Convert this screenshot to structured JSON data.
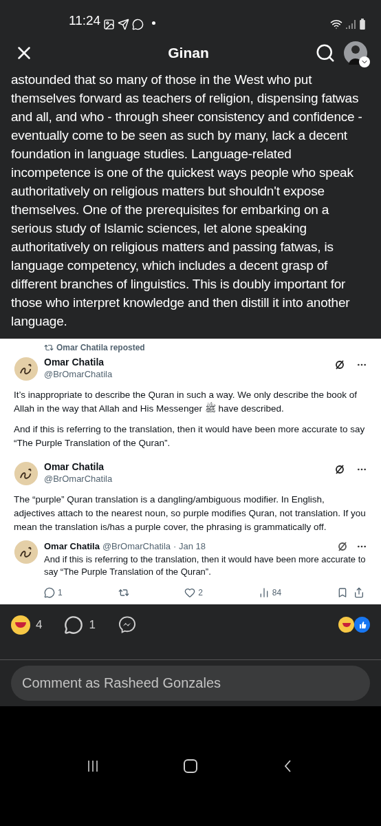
{
  "status_bar": {
    "time": "11:24"
  },
  "header": {
    "title": "Ginan"
  },
  "post": {
    "text": "astounded that so many of those in the West who put themselves forward as teachers of religion, dispensing fatwas and all, and who - through sheer consistency and confidence - eventually come to be seen as such by many, lack a decent foundation in language studies. Language-related incompetence is one of the quickest ways people who speak authoritatively on religious matters but shouldn't expose themselves. One of the prerequisites for embarking on a serious study of Islamic sciences, let alone speaking authoritatively on religious matters and passing fatwas, is language competency, which includes a decent grasp of different branches of linguistics. This is doubly important for those who interpret knowledge and then distill it into another language."
  },
  "screenshot": {
    "repost_label": "Omar Chatila reposted",
    "tweets": [
      {
        "name": "Omar Chatila",
        "handle": "@BrOmarChatila",
        "paragraphs": [
          "It’s inappropriate to describe the Quran in such a way. We only describe the book of Allah in the way that Allah and His Messenger ﷺ have described.",
          "And if this is referring to the translation, then it would have been more accurate to say “The Purple Translation of the Quran”."
        ]
      },
      {
        "name": "Omar Chatila",
        "handle": "@BrOmarChatila",
        "paragraphs": [
          "The “purple” Quran translation is a dangling/ambiguous modifier. In English, adjectives attach to the nearest noun, so purple modifies Quran, not translation. If you mean the translation is/has a purple cover, the phrasing is grammatically off."
        ]
      }
    ],
    "quoted": {
      "name": "Omar Chatila",
      "handle": "@BrOmarChatila",
      "date": "· Jan 18",
      "text": "And if this is referring to the translation, then it would have been more accurate to say “The Purple Translation of the Quran”."
    },
    "actions": {
      "replies": "1",
      "likes": "2",
      "views": "84"
    }
  },
  "reactions": {
    "count": "4",
    "comments": "1"
  },
  "comment": {
    "placeholder": "Comment as Rasheed Gonzales"
  }
}
